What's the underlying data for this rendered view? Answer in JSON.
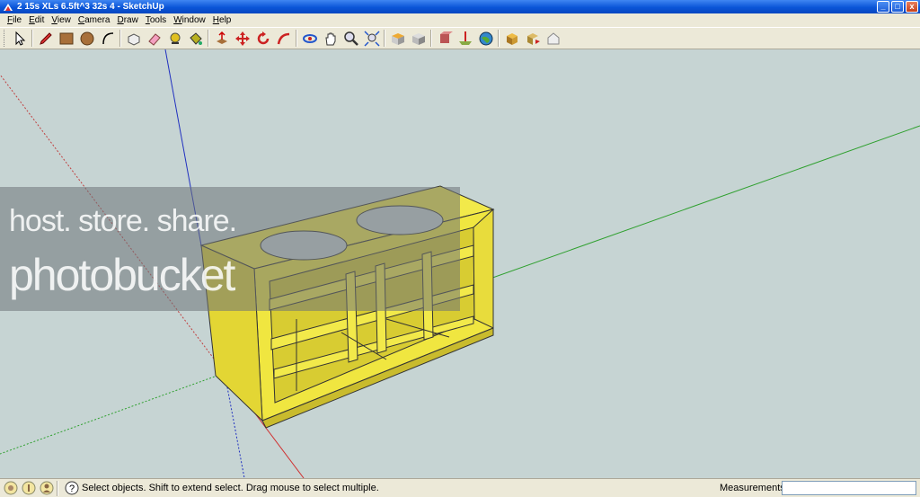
{
  "window": {
    "title": "2 15s XLs 6.5ft^3 32s 4 - SketchUp",
    "buttons": {
      "minimize": "_",
      "maximize": "□",
      "close": "x"
    }
  },
  "menu": {
    "items": [
      "File",
      "Edit",
      "View",
      "Camera",
      "Draw",
      "Tools",
      "Window",
      "Help"
    ]
  },
  "toolbar": {
    "tools": [
      "select-arrow-icon",
      "pencil-icon",
      "rectangle-icon",
      "circle-icon",
      "arc-icon",
      "make-component-icon",
      "eraser-icon",
      "tape-measure-icon",
      "paint-bucket-icon",
      "push-pull-icon",
      "move-icon",
      "rotate-icon",
      "follow-me-icon",
      "orbit-icon",
      "pan-icon",
      "zoom-icon",
      "zoom-extents-icon",
      "top-view-icon",
      "iso-view-icon",
      "get-models-icon",
      "add-location-icon",
      "google-earth-icon",
      "components-icon",
      "share-model-icon",
      "preview-icon"
    ]
  },
  "watermark": {
    "line1": "host. store. share.",
    "line2": "photobucket"
  },
  "status": {
    "hint": "Select objects. Shift to extend select. Drag mouse to select multiple.",
    "measurements_label": "Measurements",
    "measurements_value": ""
  },
  "colors": {
    "model_fill": "#f2e94a",
    "model_shadow": "#c9bb2d",
    "axis_red": "#d03030",
    "axis_green": "#2fa02f",
    "axis_blue": "#2030c0",
    "viewport_bg": "#c6d4d3"
  }
}
